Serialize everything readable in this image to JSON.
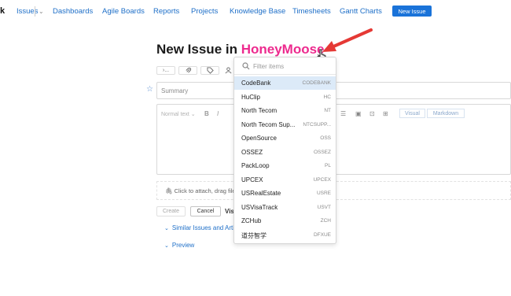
{
  "nav": {
    "logo": "k",
    "items": [
      {
        "label": "Issues",
        "has_chevron": true
      },
      {
        "label": "Dashboards"
      },
      {
        "label": "Agile Boards"
      },
      {
        "label": "Reports"
      },
      {
        "label": "Projects"
      },
      {
        "label": "Knowledge Base"
      },
      {
        "label": "Timesheets"
      },
      {
        "label": "Gantt Charts"
      }
    ],
    "new_issue_button": "New Issue"
  },
  "title": {
    "prefix": "New Issue in",
    "project": "HoneyMoose"
  },
  "toolbar": {
    "icons": [
      "command-icon",
      "attachment-icon",
      "tag-icon",
      "user-icon"
    ],
    "cmd_text": "›..."
  },
  "summary": {
    "placeholder": "Summary"
  },
  "editor": {
    "text_style": "Normal text",
    "bold": "B",
    "italic": "I",
    "visual_tab": "Visual",
    "markdown_tab": "Markdown"
  },
  "attach": {
    "text": "Click to attach, drag files"
  },
  "actions": {
    "create": "Create",
    "cancel": "Cancel",
    "visibility": "Vis"
  },
  "links": {
    "similar": "Similar Issues and Arti",
    "preview": "Preview"
  },
  "dropdown": {
    "filter_placeholder": "Filter items",
    "selected_index": 0,
    "items": [
      {
        "name": "CodeBank",
        "key": "CODEBANK"
      },
      {
        "name": "HuClip",
        "key": "HC"
      },
      {
        "name": "North Tecom",
        "key": "NT"
      },
      {
        "name": "North Tecom Sup...",
        "key": "NTCSUPP..."
      },
      {
        "name": "OpenSource",
        "key": "OSS"
      },
      {
        "name": "OSSEZ",
        "key": "OSSEZ"
      },
      {
        "name": "PackLoop",
        "key": "PL"
      },
      {
        "name": "UPCEX",
        "key": "UPCEX"
      },
      {
        "name": "USRealEstate",
        "key": "USRE"
      },
      {
        "name": "USVisaTrack",
        "key": "USVT"
      },
      {
        "name": "ZCHub",
        "key": "ZCH"
      },
      {
        "name": "道芬智学",
        "key": "DFXUE"
      }
    ]
  },
  "colors": {
    "accent": "#1a73d9",
    "project": "#ed2a8e",
    "annotation_arrow": "#e53935",
    "selected_row": "#dceaf8"
  }
}
